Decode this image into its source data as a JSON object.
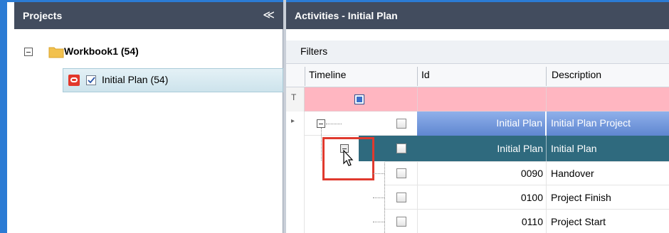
{
  "projects_panel": {
    "title": "Projects",
    "collapse_glyph": "≪",
    "workbook_label": "Workbook1 (54)",
    "plan_label": "Initial  Plan (54)"
  },
  "activities_panel": {
    "title": "Activities - Initial  Plan",
    "filters_label": "Filters",
    "columns": {
      "timeline": "Timeline",
      "id": "Id",
      "description": "Description"
    },
    "filter_row_glyph": "T",
    "row_indicator_glyph": "▸",
    "rows": [
      {
        "id": "Initial  Plan",
        "description": "Initial  Plan Project"
      },
      {
        "id": "Initial  Plan",
        "description": "Initial  Plan"
      },
      {
        "id": "0090",
        "description": "Handover"
      },
      {
        "id": "0100",
        "description": "Project Finish"
      },
      {
        "id": "0110",
        "description": "Project Start"
      }
    ]
  },
  "colors": {
    "header_bg": "#424c5e",
    "filter_row_bg": "#ffb6c1",
    "row_blue": "#6b8ed6",
    "row_teal": "#2f6a7e",
    "highlight_box": "#e03a2e",
    "selection_bg": "#cde3ec"
  }
}
